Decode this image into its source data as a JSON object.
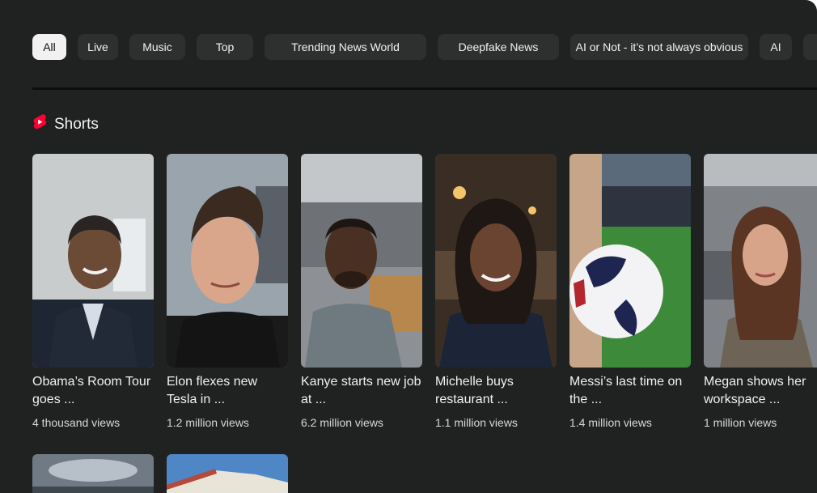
{
  "chips": [
    {
      "label": "All",
      "active": true
    },
    {
      "label": "Live",
      "active": false
    },
    {
      "label": "Music",
      "active": false
    },
    {
      "label": "Top",
      "active": false
    },
    {
      "label": "Trending News World",
      "active": false
    },
    {
      "label": "Deepfake News",
      "active": false
    },
    {
      "label": "AI or Not - it’s not always obvious",
      "active": false
    },
    {
      "label": "AI",
      "active": false
    }
  ],
  "shorts": {
    "title": "Shorts",
    "icon": "youtube-shorts-icon",
    "accent": "#ff0033",
    "items": [
      {
        "title": "Obama’s Room Tour goes ...",
        "views": "4 thousand views"
      },
      {
        "title": "Elon flexes new Tesla in ...",
        "views": "1.2 million views"
      },
      {
        "title": "Kanye starts new job at ...",
        "views": "6.2 million views"
      },
      {
        "title": "Michelle buys restaurant ...",
        "views": "1.1 million views"
      },
      {
        "title": "Messi’s last time on the ...",
        "views": "1.4 million views"
      },
      {
        "title": "Megan shows her workspace ...",
        "views": "1 million views"
      }
    ]
  }
}
